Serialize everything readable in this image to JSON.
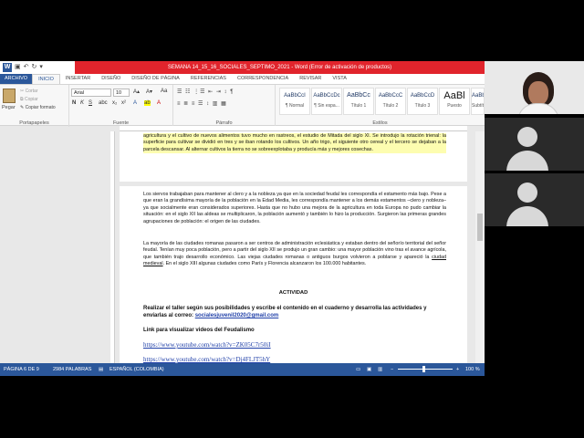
{
  "window": {
    "title": "SEMANA 14_15_16_SOCIALES_SEPTIMO_2021 - Word (Error de activación de productos)"
  },
  "tabs": [
    "ARCHIVO",
    "INICIO",
    "INSERTAR",
    "DISEÑO",
    "DISEÑO DE PÁGINA",
    "REFERENCIAS",
    "CORRESPONDENCIA",
    "REVISAR",
    "VISTA"
  ],
  "ribbon": {
    "clipboard": {
      "paste": "Pegar",
      "cut": "Cortar",
      "copy": "Copiar",
      "format_painter": "Copiar formato",
      "label": "Portapapeles"
    },
    "font": {
      "name": "Arial",
      "size": "10",
      "label": "Fuente",
      "bold": "N",
      "italic": "K",
      "underline": "S"
    },
    "paragraph": {
      "label": "Párrafo"
    },
    "styles": {
      "label": "Estilos",
      "items": [
        {
          "preview": "AaBbCcI",
          "name": "¶ Normal"
        },
        {
          "preview": "AaBbCcDc",
          "name": "¶ Sin espa..."
        },
        {
          "preview": "AaBbCc",
          "name": "Título 1"
        },
        {
          "preview": "AaBbCcC",
          "name": "Título 2"
        },
        {
          "preview": "AaBbCcD",
          "name": "Título 3"
        },
        {
          "preview": "AaBl",
          "name": "Puesto"
        },
        {
          "preview": "AaBbC",
          "name": "Subtítulo"
        }
      ]
    }
  },
  "document": {
    "page1_top": "agricultura y el cultivo de nuevos alimentos tuvo mucho en rastreos, el estudio de Mitada del siglo XI. Se introdujo la rotación trienal: la superficie para cultivar se dividió en tres y se iban rotando los cultivos. Un año trigo, el siguiente otro cereal y el tercero se dejaban a la parcela descansar. Al alternar cultivos la tierra no se sobreexplotaba y producía más y mejores cosechas.",
    "para1": "Los siervos trabajaban para mantener al clero y a la nobleza ya que en la sociedad feudal les correspondía el estamento más bajo. Pese a que eran la grandísima mayoría de la población en la Edad Media, les correspondía mantener a los demás estamentos –clero y nobleza– ya que socialmente eran considerados superiores. Hasta que no hubo una mejora de la agricultura en toda Europa no pudo cambiar la situación: en el siglo XII las aldeas se multiplicaron, la población aumentó y también lo hizo la producción. Surgieron las primeras grandes agrupaciones de población: el origen de las ciudades.",
    "para2_before": "La mayoría de las ciudades romanas pasaron a ser centros de administración eclesiástica y estaban dentro del señorío territorial del señor feudal. Tenían muy poca población, pero a partir del siglo XII se produjo un gran cambio: una mayor población vino tras el avance agrícola, que también trajo desarrollo económico. Las viejas ciudades romanas o antiguos burgos volvieron a poblarse y apareció la ",
    "para2_link": "ciudad medieval",
    "para2_after": ". En el siglo XIII algunas ciudades como París y Florencia alcanzaron los 100.000 habitantes.",
    "activity_heading": "ACTIVIDAD",
    "instruction": "Realizar el taller según sus posibilidades y escribe el contenido en el cuaderno y desarrolla las actividades y envíarlas al correo: ",
    "email": "socialesjuvenil2020@gmail.com",
    "videos_heading": "Link para visualizar videos del Feudalismo",
    "link1": "https://www.youtube.com/watch?v=ZK05C7r50iI",
    "link2": "https://www.youtube.com/watch?v=Dj4FLJT5hY"
  },
  "statusbar": {
    "page": "PÁGINA 6 DE 9",
    "words": "2984 PALABRAS",
    "language": "ESPAÑOL (COLOMBIA)",
    "zoom": "100 %"
  },
  "colors": {
    "word_blue": "#2b579a",
    "title_red": "#e1242c",
    "highlight": "#fdfdb0",
    "link": "#1f3fa8"
  }
}
